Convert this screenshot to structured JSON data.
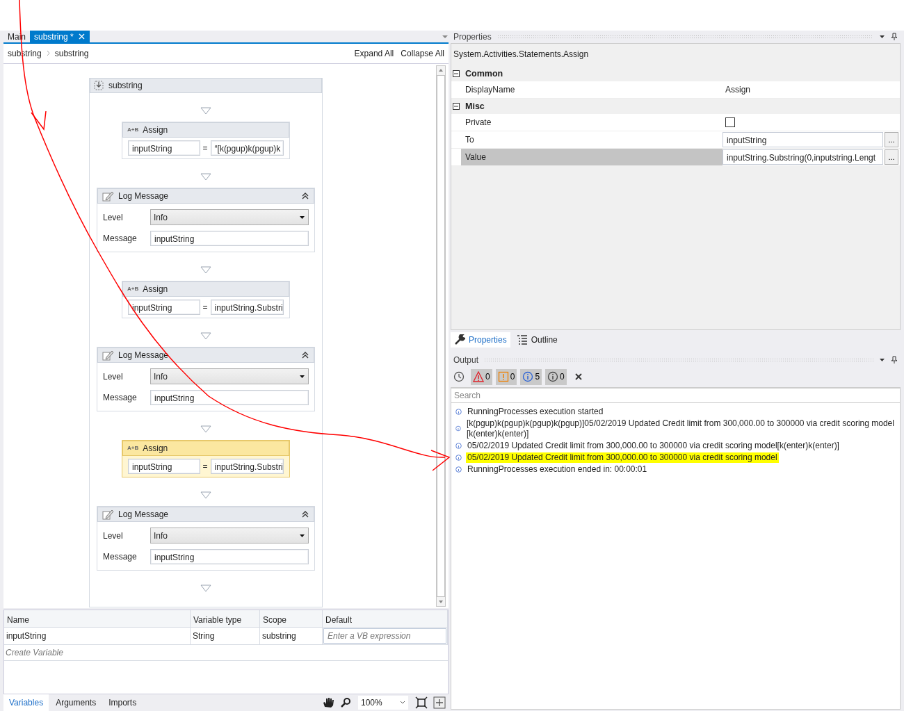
{
  "designer": {
    "tabs": [
      {
        "label": "Main",
        "selected": false,
        "closable": false
      },
      {
        "label": "substring *",
        "selected": true,
        "closable": true
      }
    ],
    "breadcrumb": [
      "substring",
      "substring"
    ],
    "actions": [
      "Expand All",
      "Collapse All"
    ],
    "sequence": {
      "title": "substring",
      "activities": [
        {
          "kind": "assign",
          "icon_text": "A+B",
          "title": "Assign",
          "to": "inputString",
          "operator": "=",
          "value": "“[k(pgup)k(pgup)k",
          "selected": false
        },
        {
          "kind": "log",
          "title": "Log Message",
          "level_label": "Level",
          "level": "Info",
          "message_label": "Message",
          "message": "inputString",
          "selected": false
        },
        {
          "kind": "assign",
          "icon_text": "A+B",
          "title": "Assign",
          "to": "inputString",
          "operator": "=",
          "value": "inputString.Substri",
          "selected": false
        },
        {
          "kind": "log",
          "title": "Log Message",
          "level_label": "Level",
          "level": "Info",
          "message_label": "Message",
          "message": "inputString",
          "selected": false
        },
        {
          "kind": "assign",
          "icon_text": "A+B",
          "title": "Assign",
          "to": "inputString",
          "operator": "=",
          "value": "inputString.Substri",
          "selected": true
        },
        {
          "kind": "log",
          "title": "Log Message",
          "level_label": "Level",
          "level": "Info",
          "message_label": "Message",
          "message": "inputString",
          "selected": false
        }
      ]
    }
  },
  "variables": {
    "columns": [
      "Name",
      "Variable type",
      "Scope",
      "Default"
    ],
    "rows": [
      {
        "name": "inputString",
        "type": "String",
        "scope": "substring",
        "default_placeholder": "Enter a VB expression"
      }
    ],
    "create_placeholder": "Create Variable"
  },
  "bottom_tabs": [
    {
      "label": "Variables",
      "selected": true
    },
    {
      "label": "Arguments",
      "selected": false
    },
    {
      "label": "Imports",
      "selected": false
    }
  ],
  "zoom": "100%",
  "properties": {
    "title": "Properties",
    "type_name": "System.Activities.Statements.Assign",
    "categories": [
      {
        "name": "Common",
        "expanded": true,
        "rows": [
          {
            "kind": "text",
            "label": "DisplayName",
            "value": "Assign",
            "selected": false
          }
        ]
      },
      {
        "name": "Misc",
        "expanded": true,
        "rows": [
          {
            "kind": "checkbox",
            "label": "Private",
            "checked": false,
            "selected": false
          },
          {
            "kind": "expression",
            "label": "To",
            "value": "inputString",
            "button": "...",
            "selected": false
          },
          {
            "kind": "expression",
            "label": "Value",
            "value": "inputString.Substring(0,inputstring.Lengt",
            "button": "...",
            "selected": true
          }
        ]
      }
    ]
  },
  "panel_tabs": [
    {
      "label": "Properties",
      "selected": true
    },
    {
      "label": "Outline",
      "selected": false
    }
  ],
  "output": {
    "title": "Output",
    "filters": [
      {
        "kind": "error",
        "count": "0"
      },
      {
        "kind": "warning",
        "count": "0"
      },
      {
        "kind": "info",
        "count": "5"
      },
      {
        "kind": "trace",
        "count": "0"
      }
    ],
    "search_placeholder": "Search",
    "lines": [
      {
        "text": "RunningProcesses execution started",
        "highlighted": false
      },
      {
        "text": "[k(pgup)k(pgup)k(pgup)k(pgup)]05/02/2019 Updated Credit limit from 300,000.00 to 300000 via credit scoring model [k(enter)k(enter)]",
        "highlighted": false
      },
      {
        "text": "05/02/2019 Updated Credit limit from 300,000.00 to 300000 via credit scoring model[k(enter)k(enter)]",
        "highlighted": false
      },
      {
        "text": "05/02/2019 Updated Credit limit from 300,000.00 to 300000 via credit scoring model",
        "highlighted": true
      },
      {
        "text": "RunningProcesses execution ended in: 00:00:01",
        "highlighted": false
      }
    ]
  }
}
